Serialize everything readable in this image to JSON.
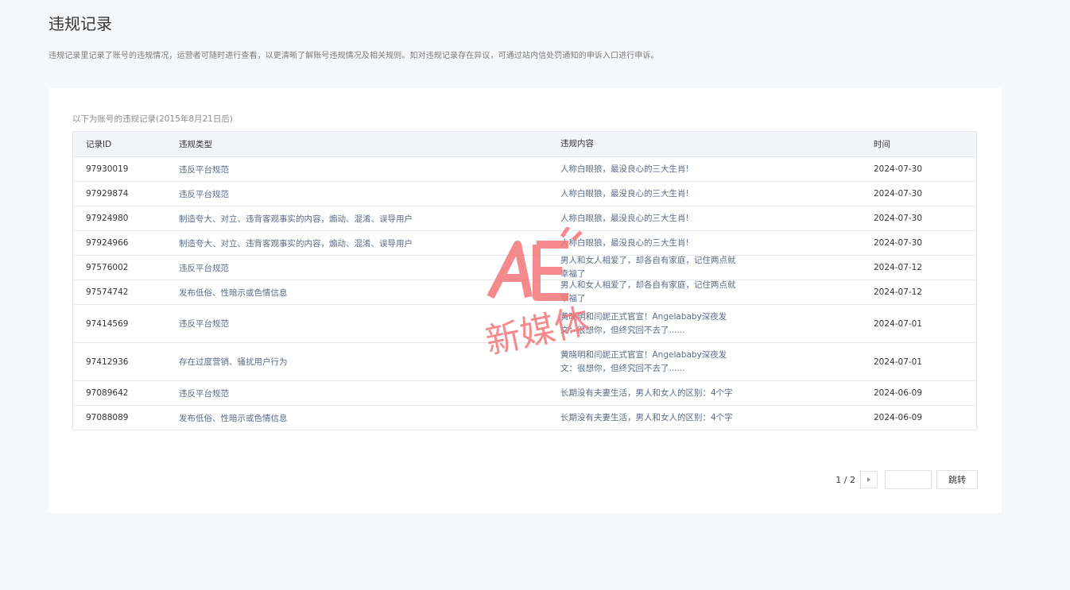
{
  "page": {
    "title": "违规记录",
    "description": "违规记录里记录了账号的违规情况，运营者可随时进行查看，以更清晰了解账号违规情况及相关规则。如对违规记录存在异议，可通过站内信处罚通知的申诉入口进行申诉。"
  },
  "card": {
    "note": "以下为账号的违规记录(2015年8月21日后)"
  },
  "table": {
    "headers": {
      "id": "记录ID",
      "type": "违规类型",
      "content": "违规内容",
      "time": "时间"
    },
    "rows": [
      {
        "id": "97930019",
        "type": "违反平台规范",
        "content": "人称白眼狼，最没良心的三大生肖!",
        "time": "2024-07-30"
      },
      {
        "id": "97929874",
        "type": "违反平台规范",
        "content": "人称白眼狼，最没良心的三大生肖!",
        "time": "2024-07-30"
      },
      {
        "id": "97924980",
        "type": "制造夸大、对立、违背客观事实的内容，煽动、混淆、误导用户",
        "content": "人称白眼狼，最没良心的三大生肖!",
        "time": "2024-07-30"
      },
      {
        "id": "97924966",
        "type": "制造夸大、对立、违背客观事实的内容，煽动、混淆、误导用户",
        "content": "人称白眼狼，最没良心的三大生肖!",
        "time": "2024-07-30"
      },
      {
        "id": "97576002",
        "type": "违反平台规范",
        "content": "男人和女人相爱了，却各自有家庭，记住两点就幸福了",
        "time": "2024-07-12"
      },
      {
        "id": "97574742",
        "type": "发布低俗、性暗示或色情信息",
        "content": "男人和女人相爱了，却各自有家庭，记住两点就幸福了",
        "time": "2024-07-12"
      },
      {
        "id": "97414569",
        "type": "违反平台规范",
        "content": "黄晓明和闫妮正式官宣！Angelababy深夜发文：很想你，但终究回不去了......",
        "time": "2024-07-01"
      },
      {
        "id": "97412936",
        "type": "存在过度营销、骚扰用户行为",
        "content": "黄晓明和闫妮正式官宣！Angelababy深夜发文：很想你，但终究回不去了......",
        "time": "2024-07-01"
      },
      {
        "id": "97089642",
        "type": "违反平台规范",
        "content": "长期没有夫妻生活，男人和女人的区别：4个字",
        "time": "2024-06-09"
      },
      {
        "id": "97088089",
        "type": "发布低俗、性暗示或色情信息",
        "content": "长期没有夫妻生活，男人和女人的区别：4个字",
        "time": "2024-06-09"
      }
    ]
  },
  "pagination": {
    "info": "1 / 2",
    "input_value": "",
    "jump_label": "跳转",
    "next_icon": "caret-right-icon"
  },
  "watermark": {
    "text": "新媒体",
    "logo": "AE",
    "color": "#f4767a"
  }
}
